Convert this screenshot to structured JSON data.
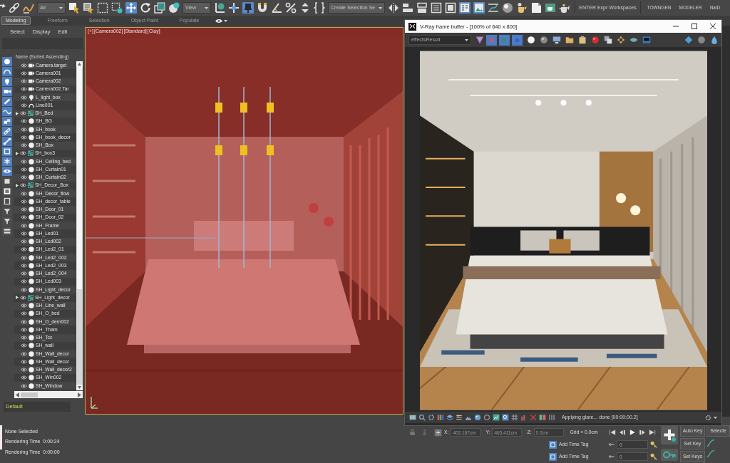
{
  "main_toolbar": {
    "items": [
      {
        "kind": "tool",
        "active": false
      },
      {
        "kind": "tool",
        "active": false
      },
      {
        "kind": "tool",
        "active": false
      },
      {
        "kind": "dropdown",
        "value": "All"
      },
      {
        "kind": "tool",
        "active": false
      },
      {
        "kind": "tool",
        "active": false
      },
      {
        "kind": "tool",
        "active": false
      },
      {
        "kind": "tool",
        "active": false
      },
      {
        "kind": "tool",
        "active": true
      },
      {
        "kind": "tool",
        "active": false
      },
      {
        "kind": "tool",
        "active": false
      },
      {
        "kind": "tool",
        "active": false
      },
      {
        "kind": "dropdown",
        "value": "View"
      },
      {
        "kind": "tool",
        "active": false
      },
      {
        "kind": "tool",
        "active": false
      },
      {
        "kind": "tool",
        "active": true
      },
      {
        "kind": "tool",
        "active": false
      },
      {
        "kind": "tool",
        "active": false
      },
      {
        "kind": "tool",
        "active": false
      },
      {
        "kind": "tool",
        "active": false
      },
      {
        "kind": "tool",
        "active": false
      },
      {
        "kind": "dropdown",
        "value": "Create Selection Se"
      },
      {
        "kind": "tool",
        "active": false
      },
      {
        "kind": "tool",
        "active": false
      },
      {
        "kind": "tool",
        "active": false
      },
      {
        "kind": "tool",
        "active": false
      },
      {
        "kind": "tool",
        "active": false
      },
      {
        "kind": "tool",
        "active": true
      },
      {
        "kind": "tool",
        "active": true
      },
      {
        "kind": "tool",
        "active": false
      },
      {
        "kind": "tool",
        "active": false
      },
      {
        "kind": "tool",
        "active": false
      },
      {
        "kind": "tool",
        "active": false
      },
      {
        "kind": "tool",
        "active": false
      },
      {
        "kind": "tool",
        "active": false
      },
      {
        "kind": "label",
        "text": "ENTER Expr Workspaces"
      },
      {
        "kind": "text_button",
        "text": "TOWNGEN"
      },
      {
        "kind": "text_button",
        "text": "MODELER"
      },
      {
        "kind": "text_button",
        "text": "NaiD"
      }
    ]
  },
  "ribbon": {
    "tabs": [
      {
        "label": "Modeling",
        "selected": true
      },
      {
        "label": "Freeform",
        "selected": false
      },
      {
        "label": "Selection",
        "selected": false
      },
      {
        "label": "Object Paint",
        "selected": false
      },
      {
        "label": "Populate",
        "selected": false
      }
    ]
  },
  "scene_explorer": {
    "menu": [
      "Select",
      "Display",
      "Edit"
    ],
    "column_header": "Name (Sorted Ascending)",
    "filters": [
      {
        "on": true
      },
      {
        "on": true
      },
      {
        "on": true
      },
      {
        "on": true
      },
      {
        "on": true
      },
      {
        "on": true
      },
      {
        "on": true
      },
      {
        "on": true
      },
      {
        "on": true
      },
      {
        "on": true
      },
      {
        "on": true
      },
      {
        "on": true
      },
      {
        "on": false
      },
      {
        "on": false
      },
      {
        "on": false
      },
      {
        "on": false
      },
      {
        "on": false
      },
      {
        "on": false
      }
    ],
    "objects": [
      {
        "kind": "camera",
        "name": "Camera.target"
      },
      {
        "kind": "camera",
        "name": "Camera001"
      },
      {
        "kind": "camera",
        "name": "Camera002"
      },
      {
        "kind": "camera",
        "name": "Camera002.Tar"
      },
      {
        "kind": "light",
        "name": "L_light_box"
      },
      {
        "kind": "shape",
        "name": "Line001"
      },
      {
        "kind": "group",
        "name": "SH_Bed"
      },
      {
        "kind": "geometry",
        "name": "SH_BG"
      },
      {
        "kind": "geometry",
        "name": "SH_book"
      },
      {
        "kind": "geometry",
        "name": "SH_book_decor"
      },
      {
        "kind": "geometry",
        "name": "SH_Box"
      },
      {
        "kind": "group",
        "name": "SH_box3"
      },
      {
        "kind": "geometry",
        "name": "SH_Ceiling_bed"
      },
      {
        "kind": "geometry",
        "name": "SH_Curtain01"
      },
      {
        "kind": "geometry",
        "name": "SH_Curtain02"
      },
      {
        "kind": "group",
        "name": "SH_Decor_Box"
      },
      {
        "kind": "geometry",
        "name": "SH_Decor_flow"
      },
      {
        "kind": "geometry",
        "name": "SH_decor_table"
      },
      {
        "kind": "geometry",
        "name": "SH_Door_01"
      },
      {
        "kind": "geometry",
        "name": "SH_Door_02"
      },
      {
        "kind": "geometry",
        "name": "SH_Frame"
      },
      {
        "kind": "geometry",
        "name": "SH_Led01"
      },
      {
        "kind": "geometry",
        "name": "SH_Led002"
      },
      {
        "kind": "geometry",
        "name": "SH_Led2_01"
      },
      {
        "kind": "geometry",
        "name": "SH_Led2_002"
      },
      {
        "kind": "geometry",
        "name": "SH_Led2_003"
      },
      {
        "kind": "geometry",
        "name": "SH_Led2_004"
      },
      {
        "kind": "geometry",
        "name": "SH_Led003"
      },
      {
        "kind": "geometry",
        "name": "SH_Light_decor"
      },
      {
        "kind": "group",
        "name": "SH_Light_decor"
      },
      {
        "kind": "geometry",
        "name": "SH_Line_wall"
      },
      {
        "kind": "geometry",
        "name": "SH_O_bed"
      },
      {
        "kind": "geometry",
        "name": "SH_O_dem002"
      },
      {
        "kind": "geometry",
        "name": "SH_Tham"
      },
      {
        "kind": "geometry",
        "name": "SH_Tcc"
      },
      {
        "kind": "geometry",
        "name": "SH_wall"
      },
      {
        "kind": "geometry",
        "name": "SH_Wall_decor"
      },
      {
        "kind": "geometry",
        "name": "SH_Wall_decor"
      },
      {
        "kind": "geometry",
        "name": "SH_Wall_decor2"
      },
      {
        "kind": "geometry",
        "name": "SH_Win002"
      },
      {
        "kind": "geometry",
        "name": "SH_Window"
      }
    ],
    "layer": "Default"
  },
  "viewport": {
    "label": [
      "[+]",
      "[Camera002]",
      "[Standard]",
      "[Clay]"
    ]
  },
  "frame_buffer": {
    "title": "V-Ray frame buffer - [100% of 640 x 800]",
    "channel": "effectsResult",
    "channel_buttons": [
      {
        "on": true
      },
      {
        "on": true
      },
      {
        "on": true
      }
    ],
    "status": "Applying glare... done [00:00:00.2]"
  },
  "status_bar": {
    "messages": [
      "None Selected",
      "Rendering Time  0:00:24",
      "Rendering Time  0:00:00"
    ],
    "coordinates": [
      {
        "axis": "X:",
        "value": "402.167cm"
      },
      {
        "axis": "Y:",
        "value": "465.411cm"
      },
      {
        "axis": "Z:",
        "value": "0.0cm"
      }
    ],
    "grid": "Grid = 0.0cm",
    "time_tags": [
      "Add Time Tag",
      "Add Time Tag"
    ],
    "frame_fields": [
      "0",
      "0"
    ],
    "key_buttons": [
      "Auto Key",
      "Set Key",
      "Set Keys"
    ],
    "filter_button": "Selecte"
  }
}
